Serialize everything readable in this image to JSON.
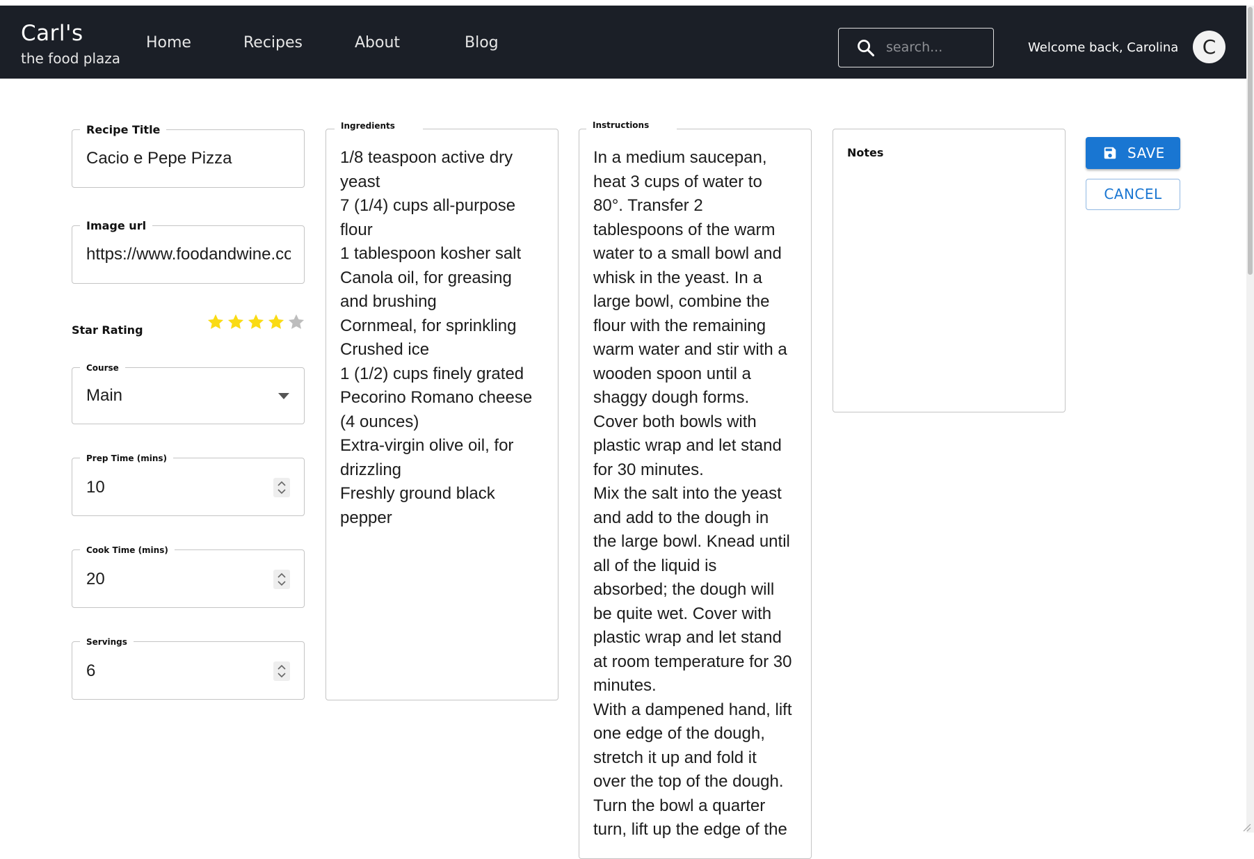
{
  "header": {
    "brand_name": "Carl's",
    "brand_tagline": "the food plaza",
    "nav": [
      {
        "label": "Home"
      },
      {
        "label": "Recipes"
      },
      {
        "label": "About"
      },
      {
        "label": "Blog"
      }
    ],
    "search_placeholder": "search...",
    "welcome": "Welcome back, Carolina",
    "avatar_initial": "C"
  },
  "form": {
    "recipe_title": {
      "label": "Recipe Title",
      "value": "Cacio e Pepe Pizza"
    },
    "image_url": {
      "label": "Image url",
      "value": "https://www.foodandwine.com"
    },
    "star_rating": {
      "label": "Star Rating",
      "value": 4,
      "max": 5
    },
    "course": {
      "label": "Course",
      "value": "Main"
    },
    "prep_time": {
      "label": "Prep Time (mins)",
      "value": "10"
    },
    "cook_time": {
      "label": "Cook Time (mins)",
      "value": "20"
    },
    "servings": {
      "label": "Servings",
      "value": "6"
    },
    "ingredients": {
      "label": "Ingredients",
      "lines": [
        "1/8 teaspoon active dry",
        "yeast",
        "7 (1/4) cups all-purpose",
        "flour",
        "1 tablespoon kosher salt",
        "Canola oil, for greasing",
        "and brushing",
        "Cornmeal, for sprinkling",
        "Crushed ice",
        "1 (1/2) cups finely grated",
        "Pecorino Romano cheese",
        "(4 ounces)",
        "Extra-virgin olive oil, for",
        "drizzling",
        "Freshly ground black",
        "pepper"
      ]
    },
    "instructions": {
      "label": "Instructions",
      "lines": [
        "In a medium saucepan,",
        "heat 3 cups of water to",
        "80°. Transfer 2",
        "tablespoons of the warm",
        "water to a small bowl and",
        "whisk in the yeast. In a",
        "large bowl, combine the",
        "flour with the remaining",
        "warm water and stir with a",
        "wooden spoon until a",
        "shaggy dough forms.",
        "Cover both bowls with",
        "plastic wrap and let stand",
        "for 30 minutes.",
        "Mix the salt into the yeast",
        "and add to the dough in",
        "the large bowl. Knead until",
        "all of the liquid is",
        "absorbed; the dough will",
        "be quite wet. Cover with",
        "plastic wrap and let stand",
        "at room temperature for 30",
        "minutes.",
        "With a dampened hand, lift",
        "one edge of the dough,",
        "stretch it up and fold it",
        "over the top of the dough.",
        "Turn the bowl a quarter",
        "turn, lift up the edge of the"
      ]
    },
    "notes": {
      "label": "Notes",
      "value": ""
    }
  },
  "actions": {
    "save_label": "SAVE",
    "cancel_label": "CANCEL"
  },
  "colors": {
    "navbar": "#1b1f27",
    "primary": "#1976d2",
    "star_filled": "#fadb14",
    "star_empty": "#bdbdbd"
  }
}
